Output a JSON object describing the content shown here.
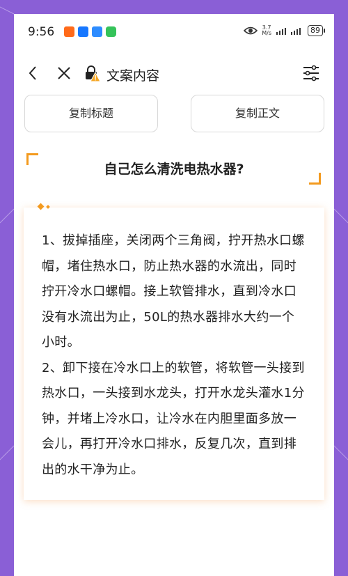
{
  "status_bar": {
    "time": "9:56",
    "network_speed_value": "3.7",
    "network_speed_unit": "M/s",
    "battery": "89"
  },
  "nav": {
    "title": "文案内容"
  },
  "buttons": {
    "copy_title": "复制标题",
    "copy_body": "复制正文"
  },
  "article": {
    "title": "自己怎么清洗电热水器?",
    "paragraphs": [
      "1、拔掉插座，关闭两个三角阀，拧开热水口螺帽，堵住热水口，防止热水器的水流出，同时拧开冷水口螺帽。接上软管排水，直到冷水口没有水流出为止，50L的热水器排水大约一个小时。",
      "2、卸下接在冷水口上的软管，将软管一头接到热水口，一头接到水龙头，打开水龙头灌水1分钟，并堵上冷水口，让冷水在内胆里面多放一会儿，再打开冷水口排水，反复几次，直到排出的水干净为止。"
    ]
  },
  "colors": {
    "background": "#8a5fd6",
    "accent": "#f39a1e",
    "warning": "#f5a623"
  },
  "icons": [
    "taobao-icon",
    "alipay-icon",
    "fliggy-icon",
    "phone-icon",
    "eye-icon",
    "signal-icon",
    "back-icon",
    "close-icon",
    "lock-warning-icon",
    "menu-icon"
  ]
}
